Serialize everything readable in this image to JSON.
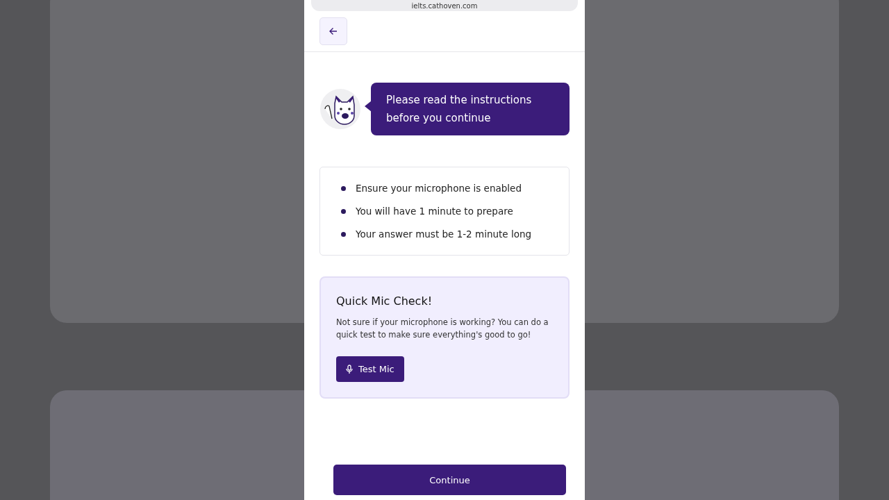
{
  "browser": {
    "url": "ielts.cathoven.com"
  },
  "intro": {
    "message": "Please read the instructions before you continue"
  },
  "instructions": [
    "Ensure your microphone is enabled",
    "You will have 1 minute to prepare",
    "Your answer must be 1-2 minute long"
  ],
  "mic_check": {
    "title": "Quick Mic Check!",
    "text": "Not sure if your microphone is working? You can do a quick test to make sure everything's good to go!",
    "button": "Test Mic"
  },
  "continue_button": "Continue"
}
